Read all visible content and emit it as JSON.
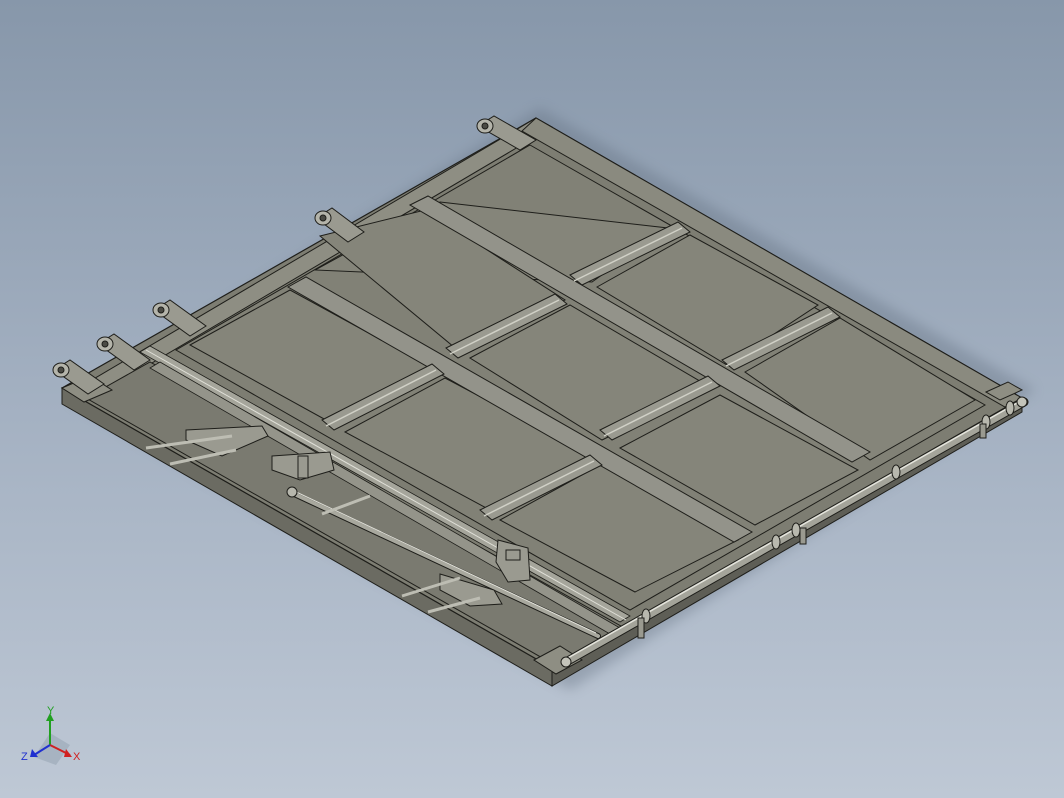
{
  "viewport": {
    "background_top": "#8797aa",
    "background_bottom": "#bec8d5"
  },
  "model": {
    "name": "dump-truck-tailgate-panel",
    "face_color": "#85857a",
    "edge_color": "#1e1e1a",
    "highlight_color": "#d0d0c6",
    "shadow_color": "#5c5c54",
    "hinge_count": 5,
    "panel_grid": {
      "rows": 3,
      "cols": 3
    }
  },
  "triad": {
    "x_label": "X",
    "y_label": "Y",
    "z_label": "Z",
    "x_color": "#d02020",
    "y_color": "#20a020",
    "z_color": "#2030d0"
  }
}
